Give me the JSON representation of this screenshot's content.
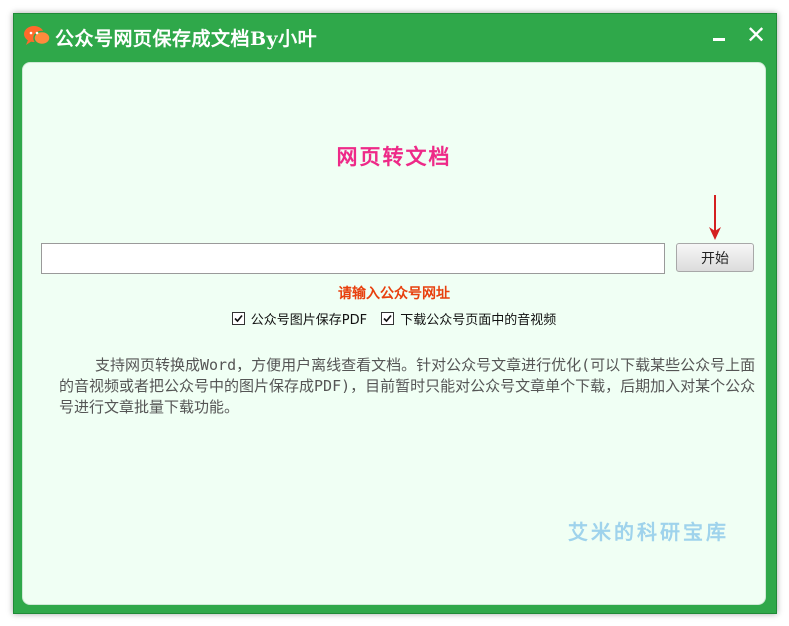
{
  "window": {
    "title": "公众号网页保存成文档By小叶",
    "minimize_glyph": "",
    "close_glyph": "✕"
  },
  "main": {
    "heading": "网页转文档",
    "url_input": {
      "value": "",
      "placeholder": ""
    },
    "start_button": "开始",
    "hint": "请输入公众号网址",
    "options": [
      {
        "label": "公众号图片保存PDF",
        "checked": true
      },
      {
        "label": "下载公众号页面中的音视频",
        "checked": true
      }
    ],
    "description": "支持网页转换成Word，方便用户离线查看文档。针对公众号文章进行优化(可以下载某些公众号上面的音视频或者把公众号中的图片保存成PDF)，目前暂时只能对公众号文章单个下载，后期加入对某个公众号进行文章批量下载功能。",
    "watermark": "艾米的科研宝库"
  },
  "colors": {
    "titlebar": "#2fa84a",
    "client_bg": "#f0fff4",
    "heading": "#ee2a88",
    "hint": "#e8400e",
    "arrow": "#d42020",
    "watermark": "#9fd3ec"
  },
  "icons": {
    "app": "wechat-icon",
    "arrow": "arrow-down-icon",
    "check": "checkmark-icon"
  }
}
